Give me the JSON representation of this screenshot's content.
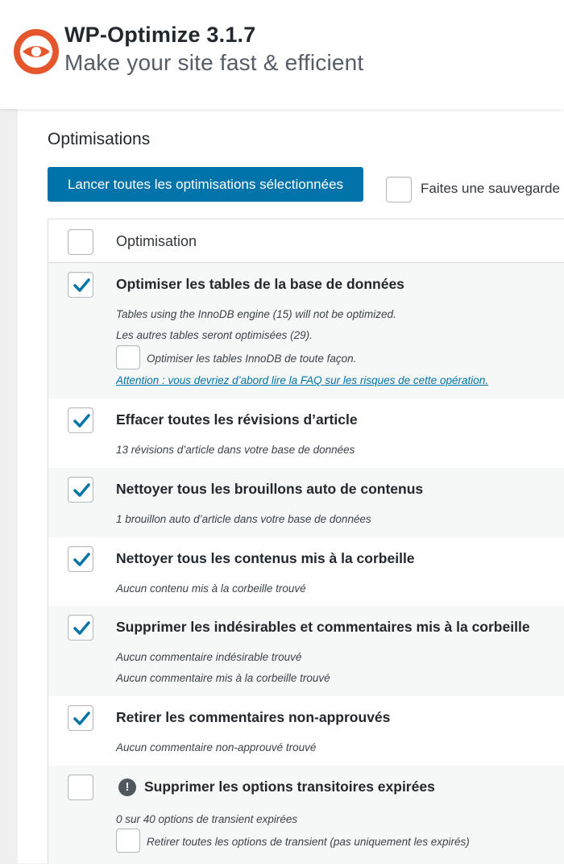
{
  "header": {
    "title": "WP-Optimize 3.1.7",
    "subtitle": "Make your site fast & efficient",
    "logo_icon": "wp-optimize-logo-icon",
    "brand_color": "#e6562d"
  },
  "section": {
    "title": "Optimisations",
    "run_button_label": "Lancer toutes les optimisations sélectionnées",
    "backup_label": "Faites une sauvegarde",
    "accent_color": "#0073aa"
  },
  "table": {
    "header_label": "Optimisation",
    "rows": [
      {
        "title": "Optimiser les tables de la base de données",
        "checked": true,
        "desc1": "Tables using the InnoDB engine (15) will not be optimized.",
        "desc2": "Les autres tables seront optimisées (29).",
        "sub_option": "Optimiser les tables InnoDB de toute façon.",
        "link": "Attention : vous devriez d’abord lire la FAQ sur les risques de cette opération."
      },
      {
        "title": "Effacer toutes les révisions d’article",
        "checked": true,
        "desc1": "13 révisions d’article dans votre base de données"
      },
      {
        "title": "Nettoyer tous les brouillons auto de contenus",
        "checked": true,
        "desc1": "1 brouillon auto d’article dans votre base de données"
      },
      {
        "title": "Nettoyer tous les contenus mis à la corbeille",
        "checked": true,
        "desc1": "Aucun contenu mis à la corbeille trouvé"
      },
      {
        "title": "Supprimer les indésirables et commentaires mis à la corbeille",
        "checked": true,
        "desc1": "Aucun commentaire indésirable trouvé",
        "desc2": "Aucun commentaire mis à la corbeille trouvé"
      },
      {
        "title": "Retirer les commentaires non-approuvés",
        "checked": true,
        "desc1": "Aucun commentaire non-approuvé trouvé"
      },
      {
        "title": "Supprimer les options transitoires expirées",
        "checked": false,
        "warning_icon": "exclamation-circle-icon",
        "warning_glyph": "!",
        "desc1": "0 sur 40 options de transient expirées",
        "sub_option": "Retirer toutes les options de transient (pas uniquement les expirés)"
      }
    ]
  }
}
